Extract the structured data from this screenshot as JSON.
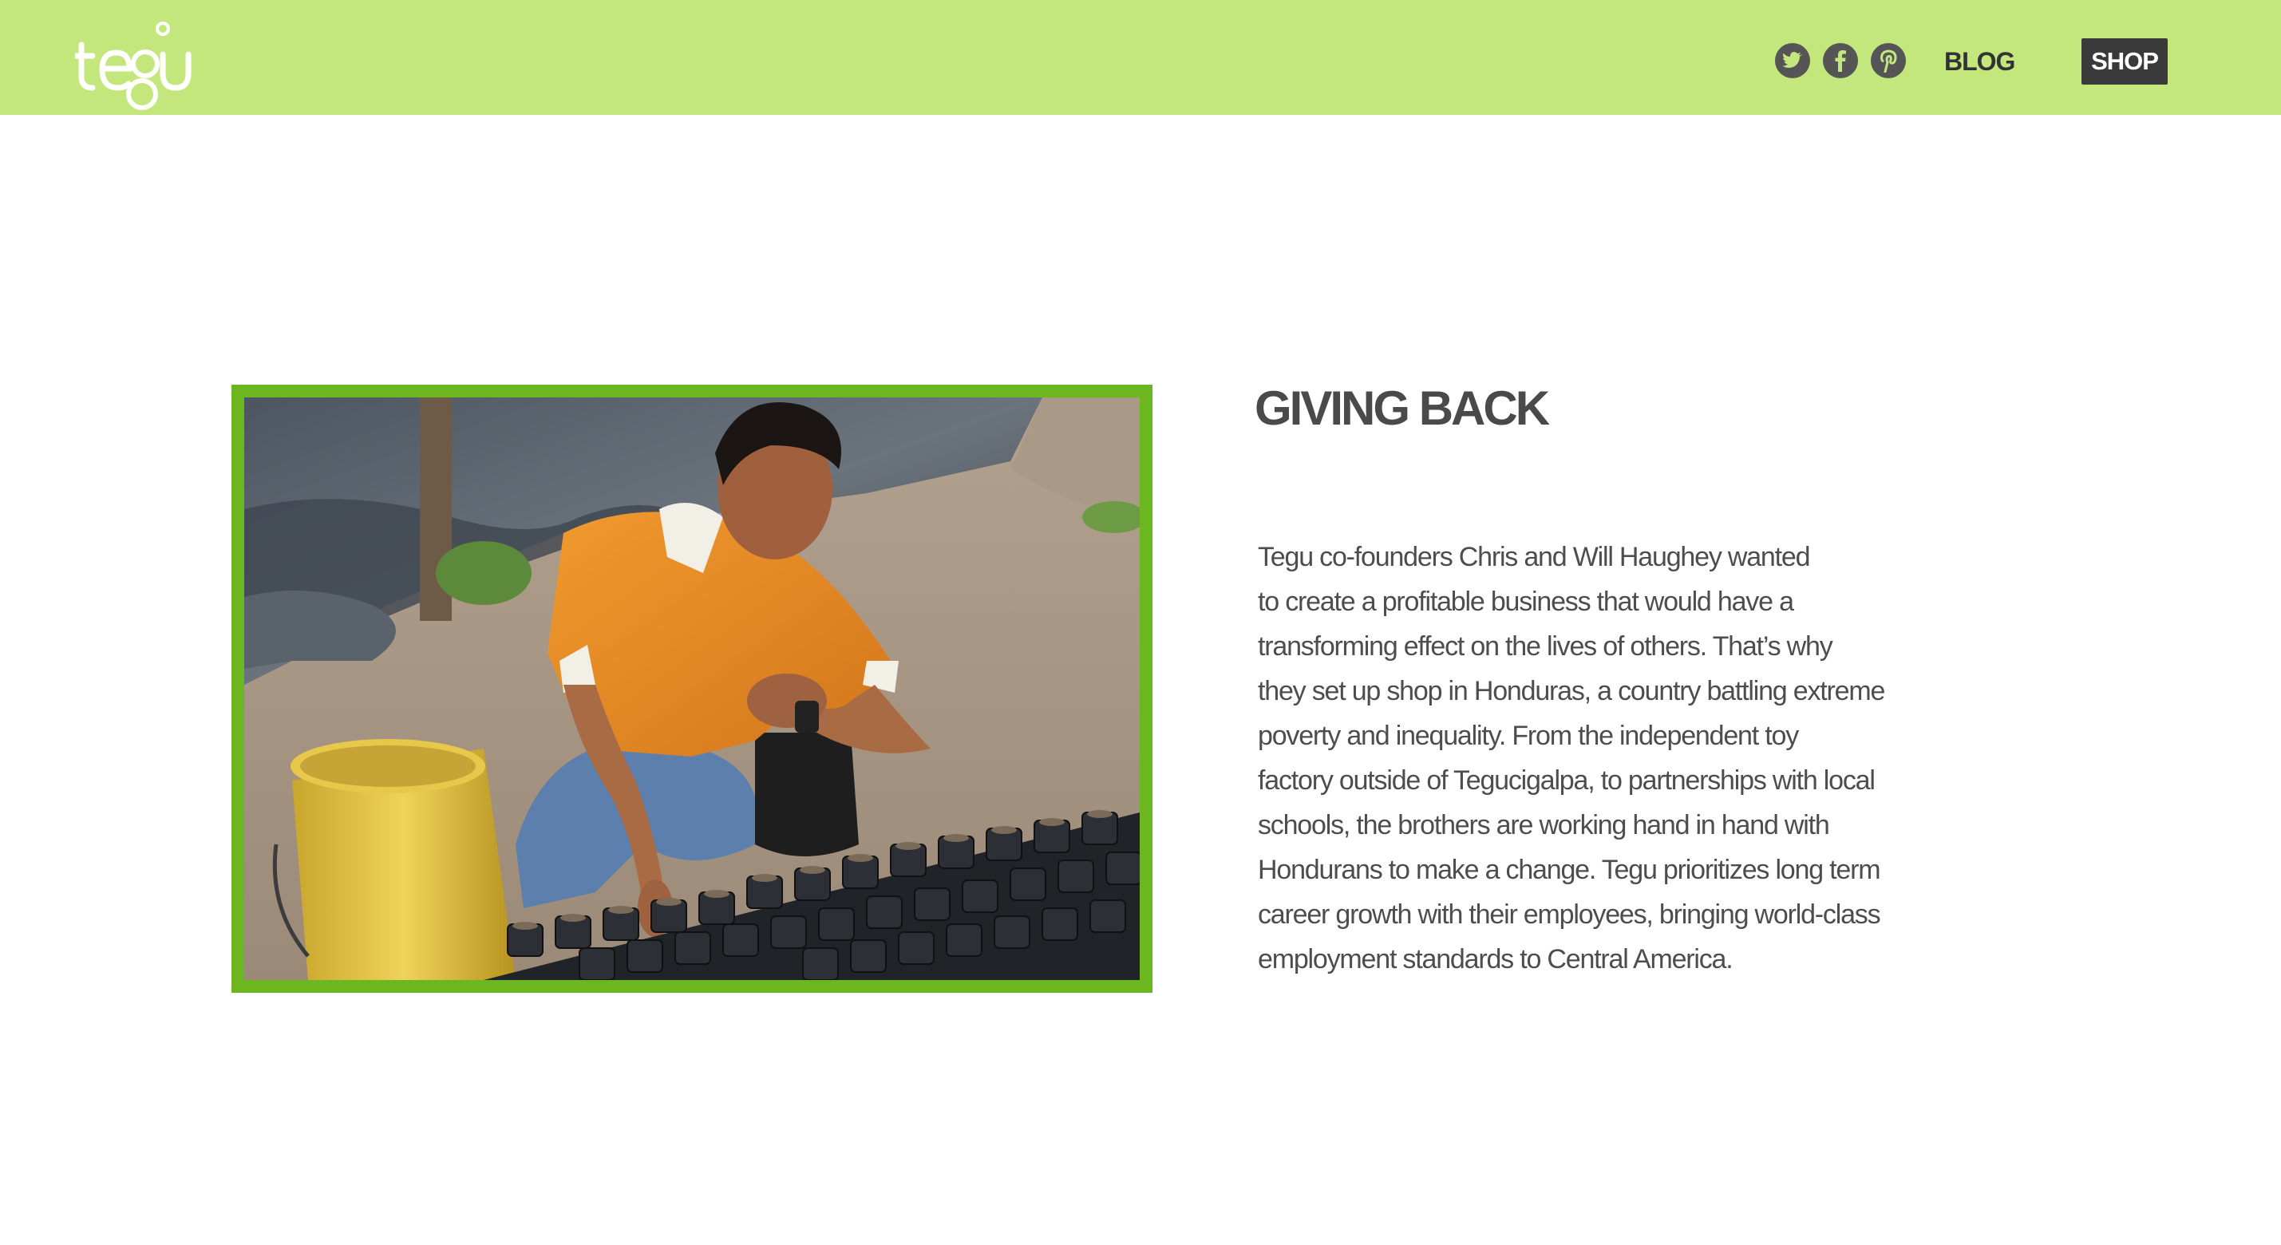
{
  "header": {
    "logo_text": "tegu",
    "nav": {
      "blog_label": "BLOG",
      "shop_label": "SHOP"
    },
    "social_icons": [
      "twitter-icon",
      "facebook-icon",
      "pinterest-icon"
    ],
    "background_color": "#c4e77d"
  },
  "main": {
    "image": {
      "subject": "man planting seedlings",
      "frame_color": "#6cb61f"
    },
    "heading": "GIVING BACK",
    "paragraph_lines": [
      "Tegu co-founders Chris and Will Haughey wanted",
      "to create a profitable business that would have a",
      "transforming effect on the lives of others. That’s why",
      "they set up shop in Honduras, a country battling extreme",
      "poverty and inequality. From the independent toy",
      "factory outside of Tegucigalpa, to partnerships with local",
      "schools, the brothers are working hand in hand with",
      "Hondurans to make a change. Tegu prioritizes long term",
      "career growth with their employees, bringing world-class",
      "employment standards to Central America."
    ]
  }
}
